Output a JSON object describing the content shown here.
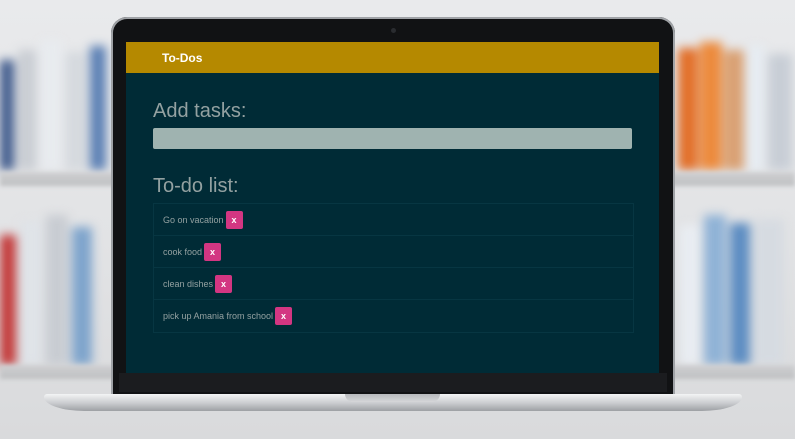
{
  "app": {
    "brand": "To-Dos"
  },
  "add_section": {
    "heading": "Add tasks:",
    "input_value": "",
    "input_placeholder": ""
  },
  "list_section": {
    "heading": "To-do list:",
    "items": [
      {
        "text": "Go on vacation",
        "delete_label": "x"
      },
      {
        "text": "cook food",
        "delete_label": "x"
      },
      {
        "text": "clean dishes",
        "delete_label": "x"
      },
      {
        "text": "pick up Amania from school",
        "delete_label": "x"
      }
    ]
  },
  "colors": {
    "navbar": "#b58900",
    "background": "#002b36",
    "text": "#93a1a1",
    "input": "#9fb3b0",
    "delete_button": "#d33682"
  }
}
